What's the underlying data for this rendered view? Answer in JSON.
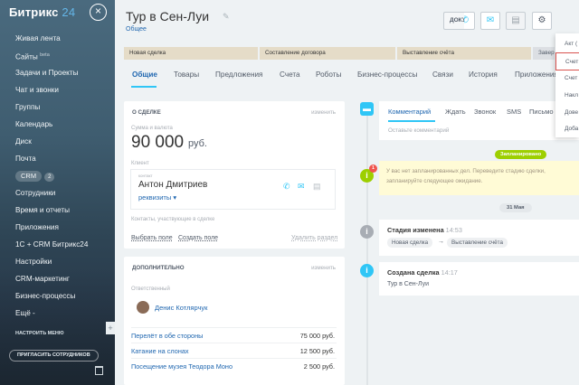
{
  "sidebar": {
    "logo_name": "Битрикс",
    "logo_num": "24",
    "close_symbol": "×",
    "items": [
      {
        "label": "Живая лента"
      },
      {
        "label": "Сайты",
        "sup": "beta"
      },
      {
        "label": "Задачи и Проекты"
      },
      {
        "label": "Чат и звонки"
      },
      {
        "label": "Группы"
      },
      {
        "label": "Календарь"
      },
      {
        "label": "Диск"
      },
      {
        "label": "Почта"
      },
      {
        "label": "CRM",
        "badge": "2"
      },
      {
        "label": "Сотрудники"
      },
      {
        "label": "Время и отчеты"
      },
      {
        "label": "Приложения"
      },
      {
        "label": "1С + CRM Битрикс24"
      },
      {
        "label": "Настройки"
      },
      {
        "label": "CRM-маркетинг"
      },
      {
        "label": "Бизнес-процессы"
      },
      {
        "label": "Ещё -"
      }
    ],
    "configure_menu": "НАСТРОИТЬ МЕНЮ",
    "invite": "ПРИГЛАСИТЬ СОТРУДНИКОВ"
  },
  "header": {
    "title": "Тур в Сен-Луи",
    "subtitle": "Общее",
    "doc_button": "ДОКУМЕНТ"
  },
  "stages": [
    "Новая сделка",
    "Составление договора",
    "Выставление счёта",
    "Заверш"
  ],
  "tabs": [
    "Общие",
    "Товары",
    "Предложения",
    "Счета",
    "Роботы",
    "Бизнес-процессы",
    "Связи",
    "История",
    "Приложения"
  ],
  "about": {
    "title": "О СДЕЛКЕ",
    "change": "изменить",
    "amount_label": "Сумма и валюта",
    "amount": "90 000",
    "currency": "руб.",
    "client_label": "Клиент",
    "contact_tag": "контакт",
    "contact_name": "Антон Дмитриев",
    "contact_link": "реквизиты ▾",
    "participants": "Контакты, участвующие в сделке",
    "choose_field": "Выбрать поле",
    "create_field": "Создать поле",
    "delete_section": "Удалить раздел"
  },
  "extra": {
    "title": "ДОПОЛНИТЕЛЬНО",
    "change": "изменить",
    "responsible_label": "Ответственный",
    "responsible_name": "Денис Котлярчук",
    "products": [
      {
        "name": "Перелёт в обе стороны",
        "price": "75 000 руб."
      },
      {
        "name": "Катание на слонах",
        "price": "12 500 руб."
      },
      {
        "name": "Посещение музея Теодора Моно",
        "price": "2 500 руб."
      }
    ]
  },
  "composer": {
    "tabs": [
      "Комментарий",
      "Ждать",
      "Звонок",
      "SMS",
      "Письмо"
    ],
    "placeholder": "Оставьте комментарий"
  },
  "timeline": {
    "planned": "Запланировано",
    "warning": "У вас нет запланированных дел. Переведите стадию сделки, запланируйте следующее ожидание.",
    "warning_count": "1",
    "date": "31 Мая",
    "stage_changed_title": "Стадия изменена",
    "stage_changed_time": "14:53",
    "stage_from": "Новая сделка",
    "stage_arrow": "→",
    "stage_to": "Выставление счёта",
    "created_title": "Создана сделка",
    "created_time": "14:17",
    "created_text": "Тур в Сен-Луи"
  },
  "dropdown": [
    "Акт (",
    "Счет",
    "Счет",
    "Накл",
    "Дове",
    "Доба"
  ],
  "colors": {
    "accent": "#2fc6f6",
    "link": "#2067b0",
    "planned": "#9dcf00",
    "warning_dot": "#9dcf00",
    "timeline_dot": "#2fc6f6",
    "gray_dot": "#a8adb4"
  },
  "icons": [
    "pencil-icon",
    "phone-icon",
    "mail-icon",
    "chat-icon",
    "gear-icon",
    "info-icon",
    "trash-icon"
  ]
}
